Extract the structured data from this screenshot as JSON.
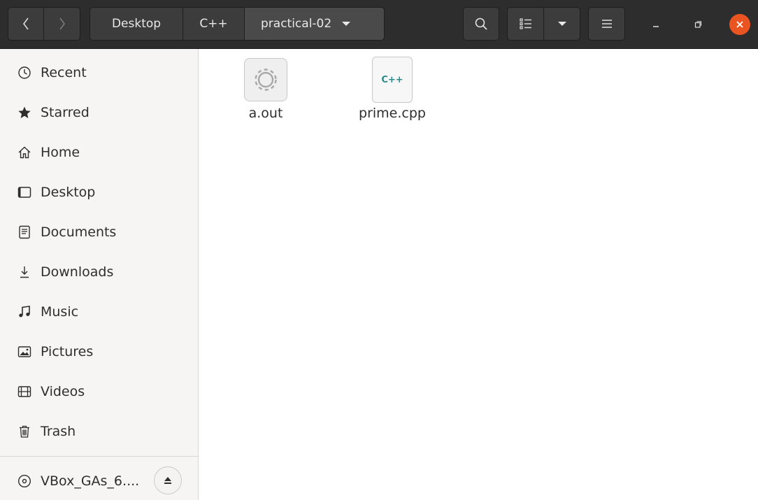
{
  "header": {
    "breadcrumbs": [
      "Desktop",
      "C++",
      "practical-02"
    ],
    "icons": {
      "back": "chevron-left-icon",
      "forward": "chevron-right-icon",
      "search": "search-icon",
      "view": "list-view-icon",
      "view_menu": "chevron-down-icon",
      "menu": "hamburger-icon",
      "minimize": "minimize-icon",
      "maximize": "maximize-icon",
      "close": "close-icon"
    },
    "accent_close": "#e95420"
  },
  "sidebar": {
    "items": [
      {
        "label": "Recent",
        "icon": "clock-icon"
      },
      {
        "label": "Starred",
        "icon": "star-icon"
      },
      {
        "label": "Home",
        "icon": "home-icon"
      },
      {
        "label": "Desktop",
        "icon": "desktop-icon"
      },
      {
        "label": "Documents",
        "icon": "document-icon"
      },
      {
        "label": "Downloads",
        "icon": "download-icon"
      },
      {
        "label": "Music",
        "icon": "music-icon"
      },
      {
        "label": "Pictures",
        "icon": "picture-icon"
      },
      {
        "label": "Videos",
        "icon": "video-icon"
      },
      {
        "label": "Trash",
        "icon": "trash-icon"
      }
    ],
    "device": {
      "label": "VBox_GAs_6....",
      "icon": "disc-icon",
      "eject_icon": "eject-icon"
    }
  },
  "files": [
    {
      "name": "a.out",
      "icon": "executable-gear-icon"
    },
    {
      "name": "prime.cpp",
      "icon": "cpp-file-icon",
      "badge": "C++"
    }
  ]
}
